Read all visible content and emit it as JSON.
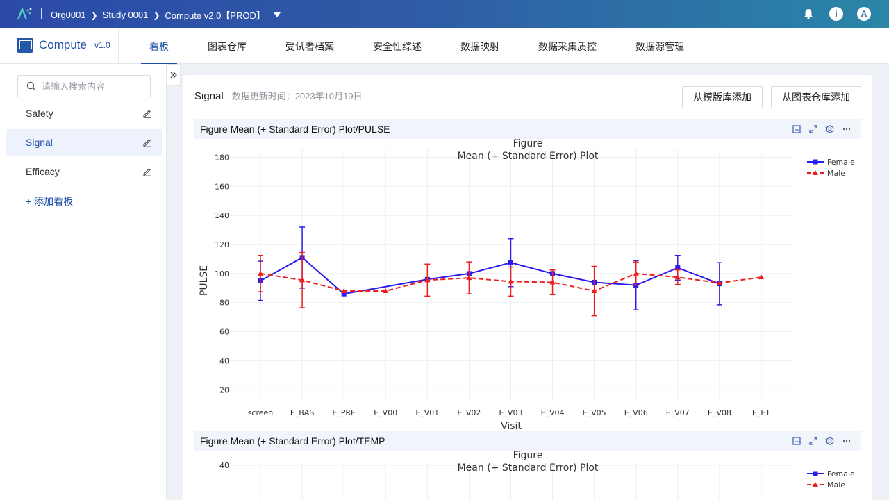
{
  "topbar": {
    "breadcrumbs": [
      "Org0001",
      "Study 0001",
      "Compute v2.0【PROD】"
    ],
    "avatar_letter": "A"
  },
  "nav": {
    "brand_name": "Compute",
    "brand_version": "v1.0",
    "tabs": [
      {
        "label": "看板",
        "active": true
      },
      {
        "label": "图表仓库",
        "active": false
      },
      {
        "label": "受试者档案",
        "active": false
      },
      {
        "label": "安全性综述",
        "active": false
      },
      {
        "label": "数据映射",
        "active": false
      },
      {
        "label": "数据采集质控",
        "active": false
      },
      {
        "label": "数据源管理",
        "active": false
      }
    ]
  },
  "sidebar": {
    "search_placeholder": "请输入搜索内容",
    "items": [
      {
        "label": "Safety",
        "active": false
      },
      {
        "label": "Signal",
        "active": true
      },
      {
        "label": "Efficacy",
        "active": false
      }
    ],
    "add_label": "+ 添加看板"
  },
  "panel": {
    "title": "Signal",
    "updated": "数据更新时间：2023年10月19日",
    "btn_template": "从模版库添加",
    "btn_repo": "从图表仓库添加"
  },
  "figures": [
    {
      "header": "Figure Mean (+ Standard Error) Plot/PULSE"
    },
    {
      "header": "Figure Mean (+ Standard Error) Plot/TEMP"
    }
  ],
  "colors": {
    "brand": "#1f4ea5",
    "female": "#2a1bf0",
    "male": "#ee1d1d"
  },
  "chart_data": [
    {
      "type": "line",
      "title": "Figure",
      "subtitle": "Mean (+ Standard Error) Plot",
      "xlabel": "Visit",
      "ylabel": "PULSE",
      "categories": [
        "screen",
        "E_BAS",
        "E_PRE",
        "E_V00",
        "E_V01",
        "E_V02",
        "E_V03",
        "E_V04",
        "E_V05",
        "E_V06",
        "E_V07",
        "E_V08",
        "E_ET"
      ],
      "yticks": [
        20,
        40,
        60,
        80,
        100,
        120,
        140,
        160,
        180
      ],
      "ylim": [
        12,
        186
      ],
      "grid": true,
      "legend_position": "top-right",
      "series": [
        {
          "name": "Female",
          "values": [
            95,
            111,
            86,
            null,
            96,
            100,
            107.5,
            100,
            94,
            92,
            104,
            93,
            null
          ],
          "error": [
            13.5,
            21,
            0,
            null,
            0,
            0,
            16.5,
            0,
            0,
            17,
            8.5,
            14.5,
            null
          ]
        },
        {
          "name": "Male",
          "values": [
            100,
            95.5,
            88,
            88,
            95.5,
            97,
            94.5,
            94,
            88,
            100,
            97.5,
            93.5,
            97.5
          ],
          "error": [
            12.5,
            19,
            0,
            0,
            11,
            11,
            10,
            8.5,
            17,
            8,
            5,
            0,
            0
          ]
        }
      ]
    },
    {
      "type": "line",
      "title": "Figure",
      "subtitle": "Mean (+ Standard Error) Plot",
      "yticks": [
        40
      ],
      "legend_position": "top-right",
      "series": [
        {
          "name": "Female",
          "values": []
        },
        {
          "name": "Male",
          "values": []
        }
      ]
    }
  ]
}
